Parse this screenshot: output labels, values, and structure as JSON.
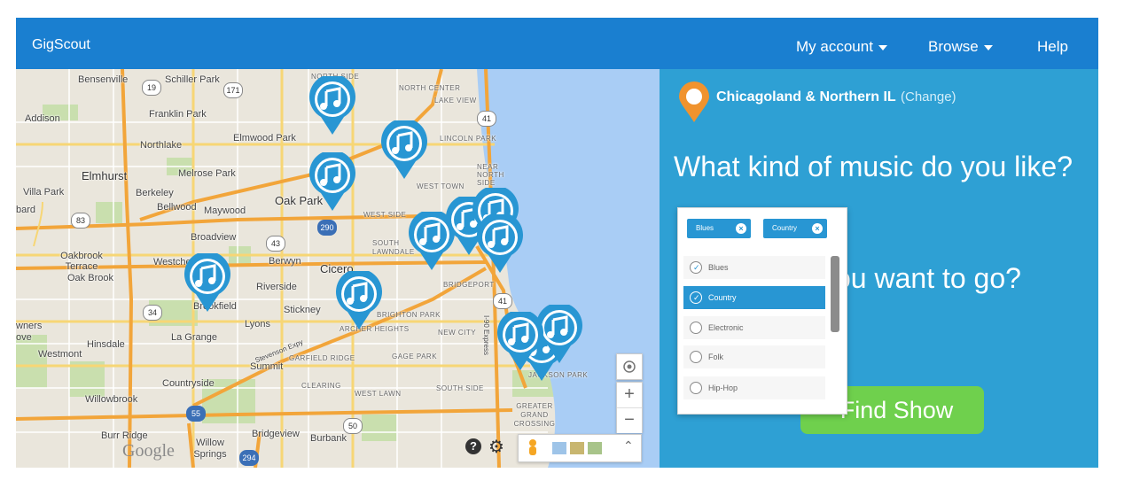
{
  "app": {
    "title": "GigScout"
  },
  "nav": {
    "account": "My account",
    "browse": "Browse",
    "help": "Help"
  },
  "panel": {
    "location": "Chicagoland & Northern IL",
    "change": "(Change)",
    "question1": "What kind of music do you like?",
    "question2_visible": "ou want to go?",
    "find_button": "Find Show"
  },
  "genre_dropdown": {
    "selected_chips": [
      "Blues",
      "Country"
    ],
    "options": [
      {
        "label": "Blues",
        "checked": true,
        "highlighted": false
      },
      {
        "label": "Country",
        "checked": true,
        "highlighted": true
      },
      {
        "label": "Electronic",
        "checked": false,
        "highlighted": false
      },
      {
        "label": "Folk",
        "checked": false,
        "highlighted": false
      },
      {
        "label": "Hip-Hop",
        "checked": false,
        "highlighted": false
      }
    ]
  },
  "map": {
    "places": [
      "Bensenville",
      "Schiller Park",
      "Addison",
      "Franklin Park",
      "Northlake",
      "Elmwood Park",
      "Elmhurst",
      "Melrose Park",
      "Villa Park",
      "Berkeley",
      "Oak Park",
      "Bellwood",
      "Maywood",
      "Lombard",
      "Broadview",
      "Westchester",
      "Berwyn",
      "Cicero",
      "Oakbrook Terrace",
      "Oak Brook",
      "Riverside",
      "Brookfield",
      "Stickney",
      "La Grange",
      "Lyons",
      "Hinsdale",
      "Westmont",
      "Summit",
      "Countryside",
      "Willowbrook",
      "Burr Ridge",
      "Bridgeview",
      "Burbank",
      "Willow Springs",
      "Downers Grove"
    ],
    "neighborhoods": [
      "NORTH SIDE",
      "NORTH CENTER",
      "LAKE VIEW",
      "LINCOLN PARK",
      "WEST TOWN",
      "WEST SIDE",
      "NEAR NORTH SIDE",
      "SOUTH LAWNDALE",
      "BRIDGEPORT",
      "BRIGHTON PARK",
      "ARCHER HEIGHTS",
      "NEW CITY",
      "GARFIELD RIDGE",
      "GAGE PARK",
      "CLEARING",
      "WEST LAWN",
      "SOUTH SIDE",
      "GREATER GRAND CROSSING",
      "JACKSON PARK"
    ],
    "routes": [
      "19",
      "171",
      "83",
      "43",
      "290",
      "34",
      "55",
      "50",
      "294",
      "41",
      "90"
    ],
    "road_label": "Stevenson Expy",
    "expy_label": "I-90 Express",
    "attribution": "Google",
    "zoom_in": "+",
    "zoom_out": "−",
    "pin_icon": "music-note-icon",
    "pin_color": "#2896d3",
    "location_marker_color": "#f0932e"
  },
  "colors": {
    "header": "#1a7fd0",
    "panel": "#2ea0d4",
    "button": "#6fd04d",
    "water": "#a9cdf5"
  }
}
